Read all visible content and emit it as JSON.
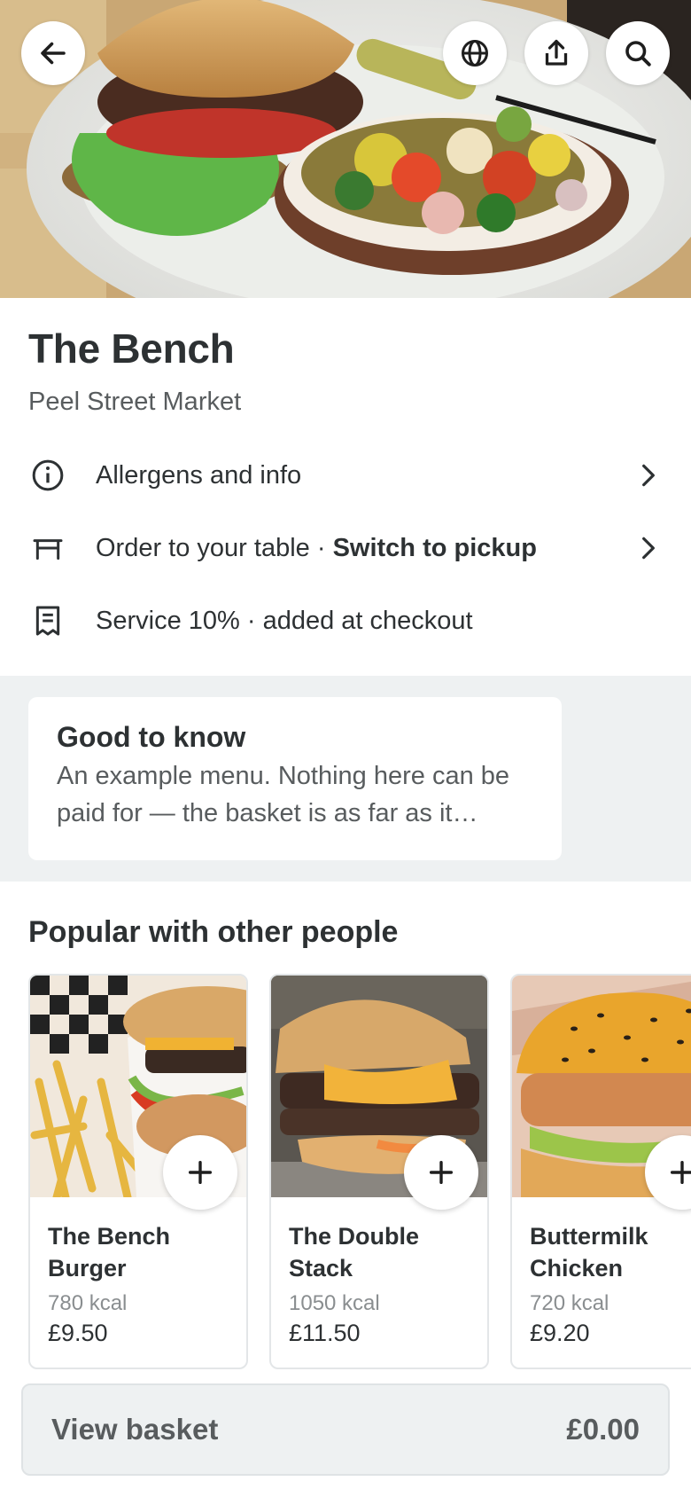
{
  "hero": {
    "back_icon": "arrow-left-icon",
    "language_icon": "globe-icon",
    "share_icon": "share-icon",
    "search_icon": "search-icon"
  },
  "venue": {
    "title": "The Bench",
    "subtitle": "Peel Street Market"
  },
  "info": {
    "allergens": {
      "icon": "info-icon",
      "label": "Allergens and info"
    },
    "table": {
      "icon": "table-icon",
      "label": "Order to your table · ",
      "action": "Switch to pickup"
    },
    "service": {
      "icon": "receipt-icon",
      "label": "Service 10% · added at checkout"
    }
  },
  "notice": {
    "title": "Good to know",
    "body": "An example menu. Nothing here can be paid for — the basket is as far as it…"
  },
  "popular": {
    "title": "Popular with other people",
    "items": [
      {
        "name": "The Bench Burger",
        "kcal": "780 kcal",
        "price": "£9.50"
      },
      {
        "name": "The Double Stack",
        "kcal": "1050 kcal",
        "price": "£11.50"
      },
      {
        "name": "Buttermilk Chicken",
        "kcal": "720 kcal",
        "price": "£9.20"
      }
    ]
  },
  "basket": {
    "label": "View basket",
    "amount": "£0.00"
  },
  "colors": {
    "text": "#2d3133",
    "muted": "#585c5e",
    "band": "#eef1f2"
  }
}
